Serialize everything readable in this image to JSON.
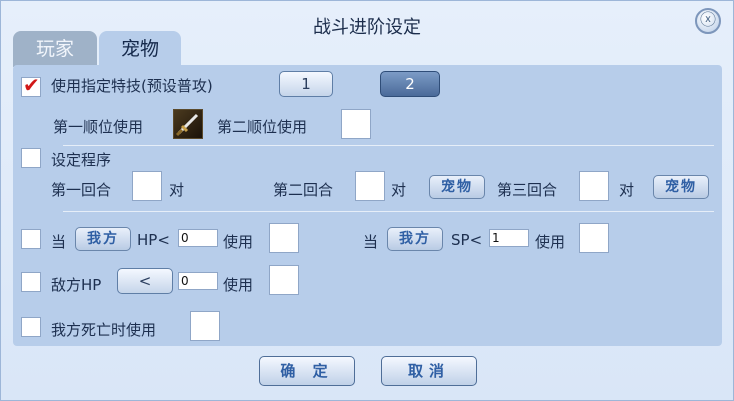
{
  "window": {
    "title": "战斗进阶设定",
    "close_glyph": "ⓧ"
  },
  "tabs": [
    {
      "label": "玩家",
      "active": false
    },
    {
      "label": "宠物",
      "active": true
    }
  ],
  "skill_section": {
    "checked": true,
    "label": "使用指定特技(预设普攻)",
    "buttons": [
      "1",
      "2"
    ],
    "first_order_label": "第一顺位使用",
    "second_order_label": "第二顺位使用"
  },
  "program_section": {
    "label": "设定程序",
    "rounds": [
      {
        "label": "第一回合",
        "vs": "对"
      },
      {
        "label": "第二回合",
        "vs": "对",
        "target": "宠物"
      },
      {
        "label": "第三回合",
        "vs": "对",
        "target": "宠物"
      }
    ]
  },
  "conditions": {
    "hp_rule": {
      "when": "当",
      "target": "我方",
      "stat": "HP<",
      "value": "0",
      "use": "使用"
    },
    "sp_rule": {
      "when": "当",
      "target": "我方",
      "stat": "SP<",
      "value": "1",
      "use": "使用"
    },
    "enemy_hp_rule": {
      "label": "敌方HP",
      "operator": "<",
      "value": "0",
      "use": "使用"
    },
    "death_rule": {
      "label": "我方死亡时使用"
    }
  },
  "footer": {
    "confirm": "确 定",
    "cancel": "取消"
  },
  "colors": {
    "background": "#dde9f9",
    "panel": "#b7cdea",
    "accent": "#2f5fa4",
    "check": "#d11818"
  }
}
